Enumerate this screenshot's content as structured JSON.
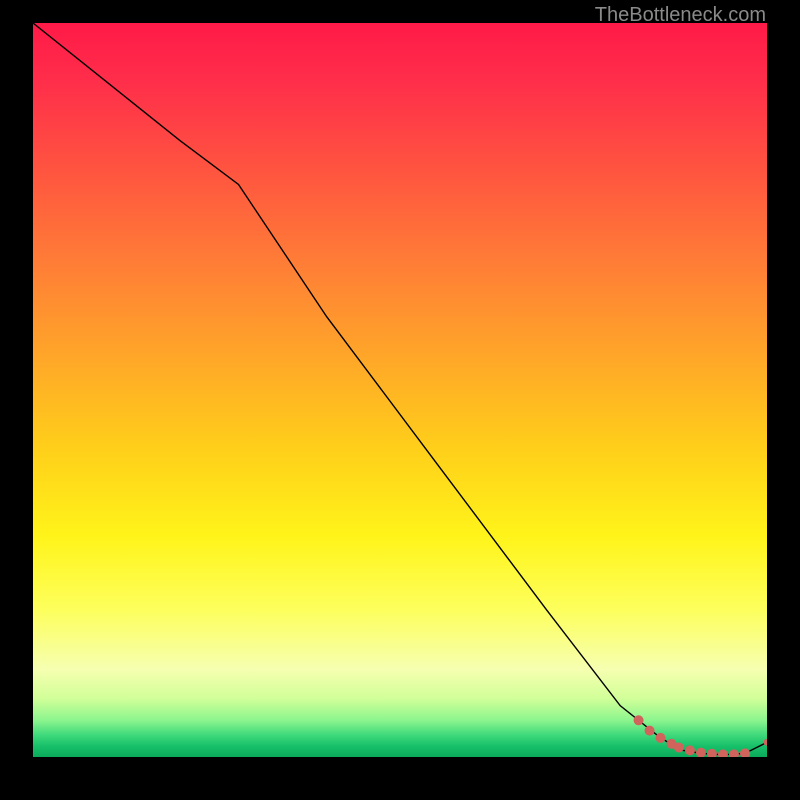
{
  "watermark": "TheBottleneck.com",
  "chart_data": {
    "type": "line",
    "title": "",
    "xlabel": "",
    "ylabel": "",
    "xlim": [
      0,
      100
    ],
    "ylim": [
      0,
      100
    ],
    "grid": false,
    "legend": false,
    "series": [
      {
        "name": "bottleneck-curve",
        "x": [
          0,
          10,
          20,
          28,
          40,
          55,
          70,
          80,
          85,
          88,
          91,
          94,
          97,
          100
        ],
        "y": [
          100,
          92,
          84,
          78,
          60,
          40,
          20,
          7,
          3,
          1,
          0.5,
          0.3,
          0.5,
          2
        ],
        "color": "#000000",
        "linewidth": 1
      }
    ],
    "scatter_points": {
      "name": "highlighted-range",
      "color": "#d0635b",
      "radius_large": 5,
      "radius_end": 3.5,
      "points": [
        {
          "x": 82.5,
          "y": 5.0,
          "r": "large"
        },
        {
          "x": 84.0,
          "y": 3.6,
          "r": "large"
        },
        {
          "x": 85.5,
          "y": 2.6,
          "r": "large"
        },
        {
          "x": 87.0,
          "y": 1.8,
          "r": "large"
        },
        {
          "x": 88.0,
          "y": 1.3,
          "r": "large"
        },
        {
          "x": 89.5,
          "y": 0.9,
          "r": "large"
        },
        {
          "x": 91.0,
          "y": 0.6,
          "r": "large"
        },
        {
          "x": 92.5,
          "y": 0.45,
          "r": "large"
        },
        {
          "x": 94.0,
          "y": 0.35,
          "r": "large"
        },
        {
          "x": 95.5,
          "y": 0.35,
          "r": "large"
        },
        {
          "x": 97.0,
          "y": 0.5,
          "r": "large"
        },
        {
          "x": 100.0,
          "y": 2.0,
          "r": "end"
        }
      ]
    }
  }
}
